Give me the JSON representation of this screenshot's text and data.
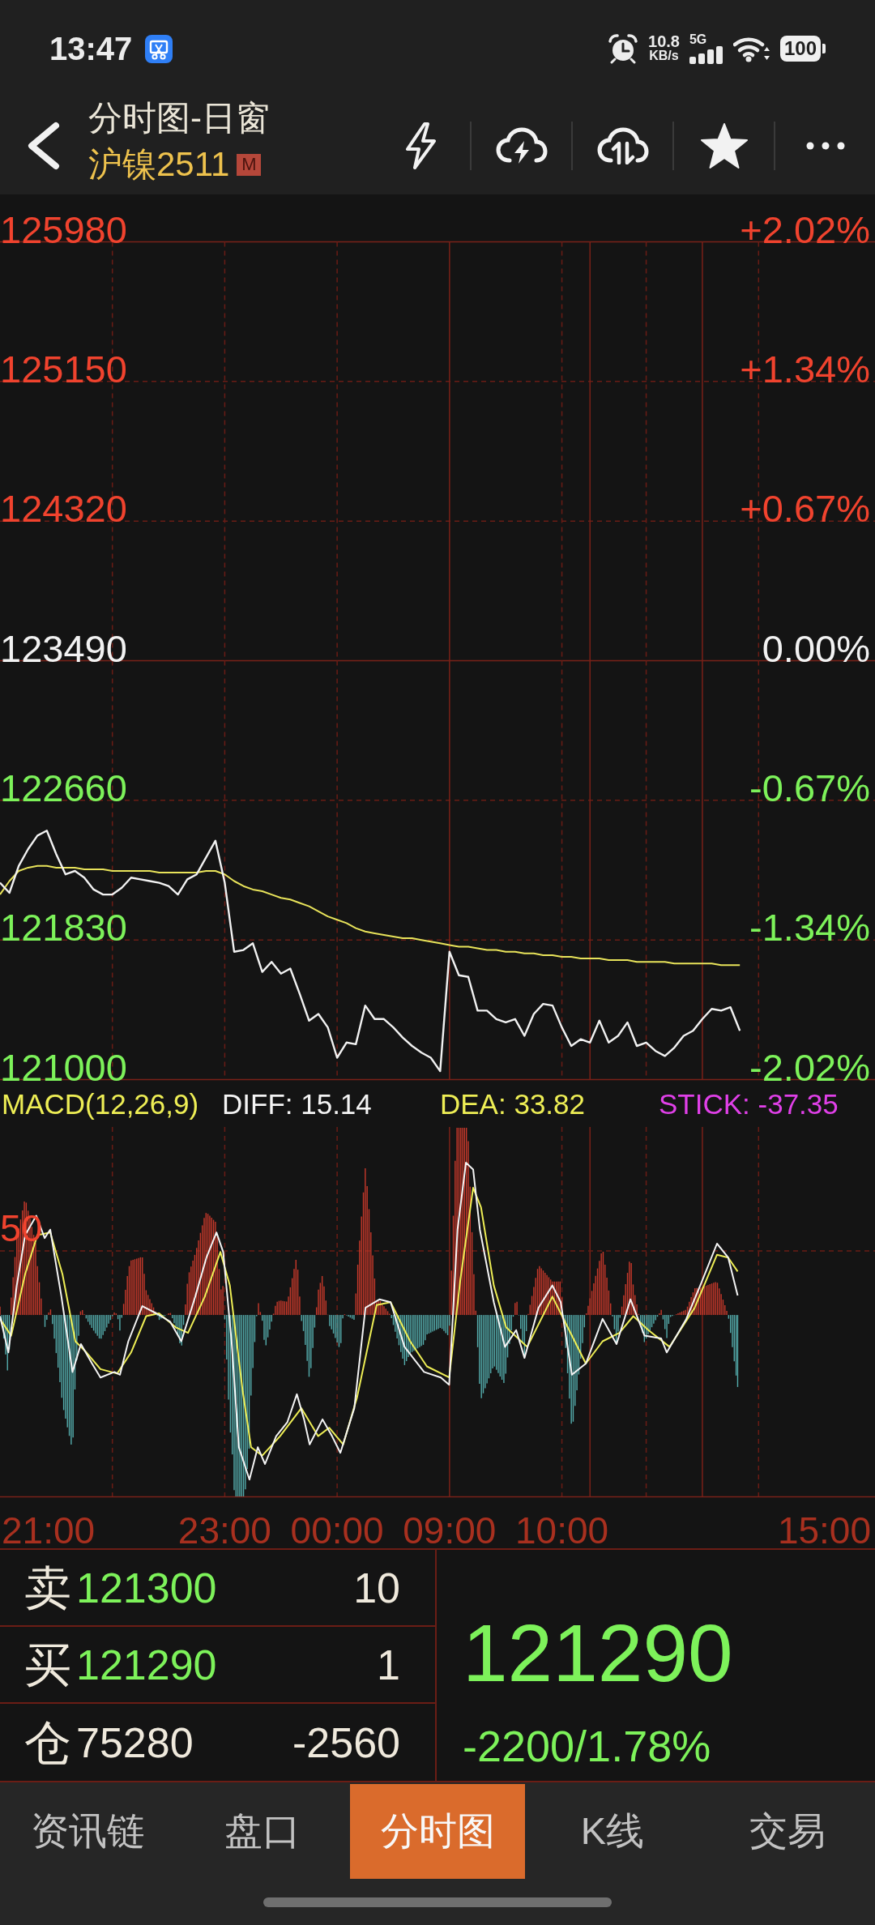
{
  "status_bar": {
    "time": "13:47",
    "net_speed": "10.8",
    "net_unit": "KB/s",
    "network": "5G",
    "battery": "100"
  },
  "header": {
    "title": "分时图-日窗",
    "symbol": "沪镍2511",
    "badge": "M"
  },
  "price_chart": {
    "chart_data": {
      "type": "line",
      "grid": true,
      "ylim": [
        121000,
        125980
      ],
      "yticks": [
        {
          "value": 125980,
          "label": "125980"
        },
        {
          "value": 125150,
          "label": "125150"
        },
        {
          "value": 124320,
          "label": "124320"
        },
        {
          "value": 123490,
          "label": "123490"
        },
        {
          "value": 122660,
          "label": "122660"
        },
        {
          "value": 121830,
          "label": "121830"
        },
        {
          "value": 121000,
          "label": "121000"
        }
      ],
      "series": [
        {
          "color": "#f2f2f2",
          "values": [
            122170,
            122110,
            122270,
            122370,
            122450,
            122480,
            122340,
            122220,
            122240,
            122200,
            122130,
            122100,
            122100,
            122140,
            122200,
            122190,
            122180,
            122170,
            122150,
            122100,
            122190,
            122220,
            122320,
            122420,
            122170,
            121760,
            121770,
            121810,
            121640,
            121700,
            121630,
            121660,
            121510,
            121350,
            121390,
            121310,
            121130,
            121220,
            121210,
            121440,
            121360,
            121360,
            121310,
            121250,
            121200,
            121160,
            121130,
            121050,
            121760,
            121620,
            121610,
            121410,
            121410,
            121360,
            121340,
            121360,
            121260,
            121390,
            121450,
            121440,
            121310,
            121200,
            121240,
            121220,
            121350,
            121220,
            121260,
            121340,
            121200,
            121220,
            121170,
            121140,
            121190,
            121260,
            121290,
            121360,
            121420,
            121410,
            121430,
            121290,
            null,
            null,
            null,
            null,
            null,
            null,
            null,
            null,
            null,
            null,
            null,
            null,
            null,
            null
          ]
        },
        {
          "color": "#e8e35a",
          "values": [
            122100,
            122180,
            122240,
            122260,
            122270,
            122270,
            122260,
            122260,
            122260,
            122250,
            122250,
            122250,
            122240,
            122240,
            122240,
            122240,
            122240,
            122230,
            122230,
            122230,
            122230,
            122230,
            122240,
            122240,
            122220,
            122180,
            122150,
            122130,
            122120,
            122100,
            122080,
            122070,
            122050,
            122030,
            122000,
            121970,
            121950,
            121930,
            121900,
            121880,
            121870,
            121860,
            121850,
            121840,
            121840,
            121830,
            121820,
            121810,
            121800,
            121790,
            121790,
            121780,
            121770,
            121770,
            121760,
            121760,
            121750,
            121750,
            121740,
            121740,
            121730,
            121730,
            121720,
            121720,
            121720,
            121710,
            121710,
            121710,
            121700,
            121700,
            121700,
            121700,
            121690,
            121690,
            121690,
            121690,
            121690,
            121680,
            121680,
            121680,
            null,
            null,
            null,
            null,
            null,
            null,
            null,
            null,
            null,
            null,
            null,
            null,
            null,
            null
          ]
        }
      ]
    },
    "percent_labels": [
      "+2.02%",
      "+1.34%",
      "+0.67%",
      "0.00%",
      "-0.67%",
      "-1.34%",
      "-2.02%"
    ],
    "time_labels": [
      "21:00",
      "23:00",
      "00:00",
      "09:00",
      "10:00",
      "15:00"
    ]
  },
  "macd": {
    "title": "MACD(12,26,9)",
    "diff": "DIFF: 15.14",
    "dea": "DEA: 33.82",
    "stick": "STICK: -37.35",
    "level_label": "50"
  },
  "quote": {
    "rows": [
      {
        "kind": "ask",
        "label": "卖",
        "price": "121300",
        "volume": "10"
      },
      {
        "kind": "bid",
        "label": "买",
        "price": "121290",
        "volume": "1"
      },
      {
        "kind": "open_interest",
        "label": "仓",
        "price": "75280",
        "volume": "-2560"
      }
    ],
    "last_price": "121290",
    "change": "-2200/1.78%"
  },
  "tabs": [
    {
      "label": "资讯链",
      "selected": false
    },
    {
      "label": "盘口",
      "selected": false
    },
    {
      "label": "分时图",
      "selected": true
    },
    {
      "label": "K线",
      "selected": false
    },
    {
      "label": "交易",
      "selected": false
    }
  ]
}
